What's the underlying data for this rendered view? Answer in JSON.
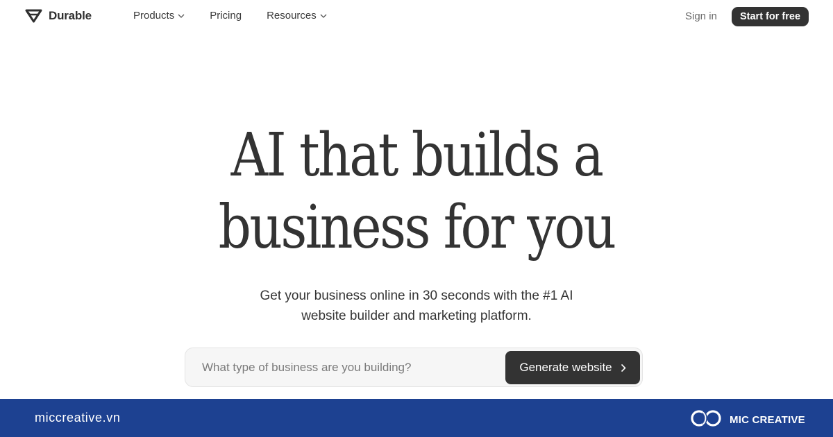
{
  "nav": {
    "logo_text": "Durable",
    "links": [
      {
        "label": "Products",
        "has_dropdown": true
      },
      {
        "label": "Pricing",
        "has_dropdown": false
      },
      {
        "label": "Resources",
        "has_dropdown": true
      }
    ],
    "sign_in": "Sign in",
    "cta": "Start for free"
  },
  "hero": {
    "title_line1": "AI that builds a",
    "title_line2": "business for you",
    "subtitle_line1": "Get your business online in 30 seconds with the #1 AI",
    "subtitle_line2": "website builder and marketing platform."
  },
  "search": {
    "placeholder": "What type of business are you building?",
    "value": "",
    "button_label": "Generate website"
  },
  "footer": {
    "domain": "miccreative.vn",
    "brand": "MIC CREATIVE"
  },
  "colors": {
    "primary_dark": "#333333",
    "footer_blue": "#1d4191",
    "search_bg": "#f6f6f6"
  },
  "icons": [
    "durable-logo-icon",
    "chevron-down-icon",
    "chevron-right-icon",
    "mic-creative-logo-icon"
  ]
}
